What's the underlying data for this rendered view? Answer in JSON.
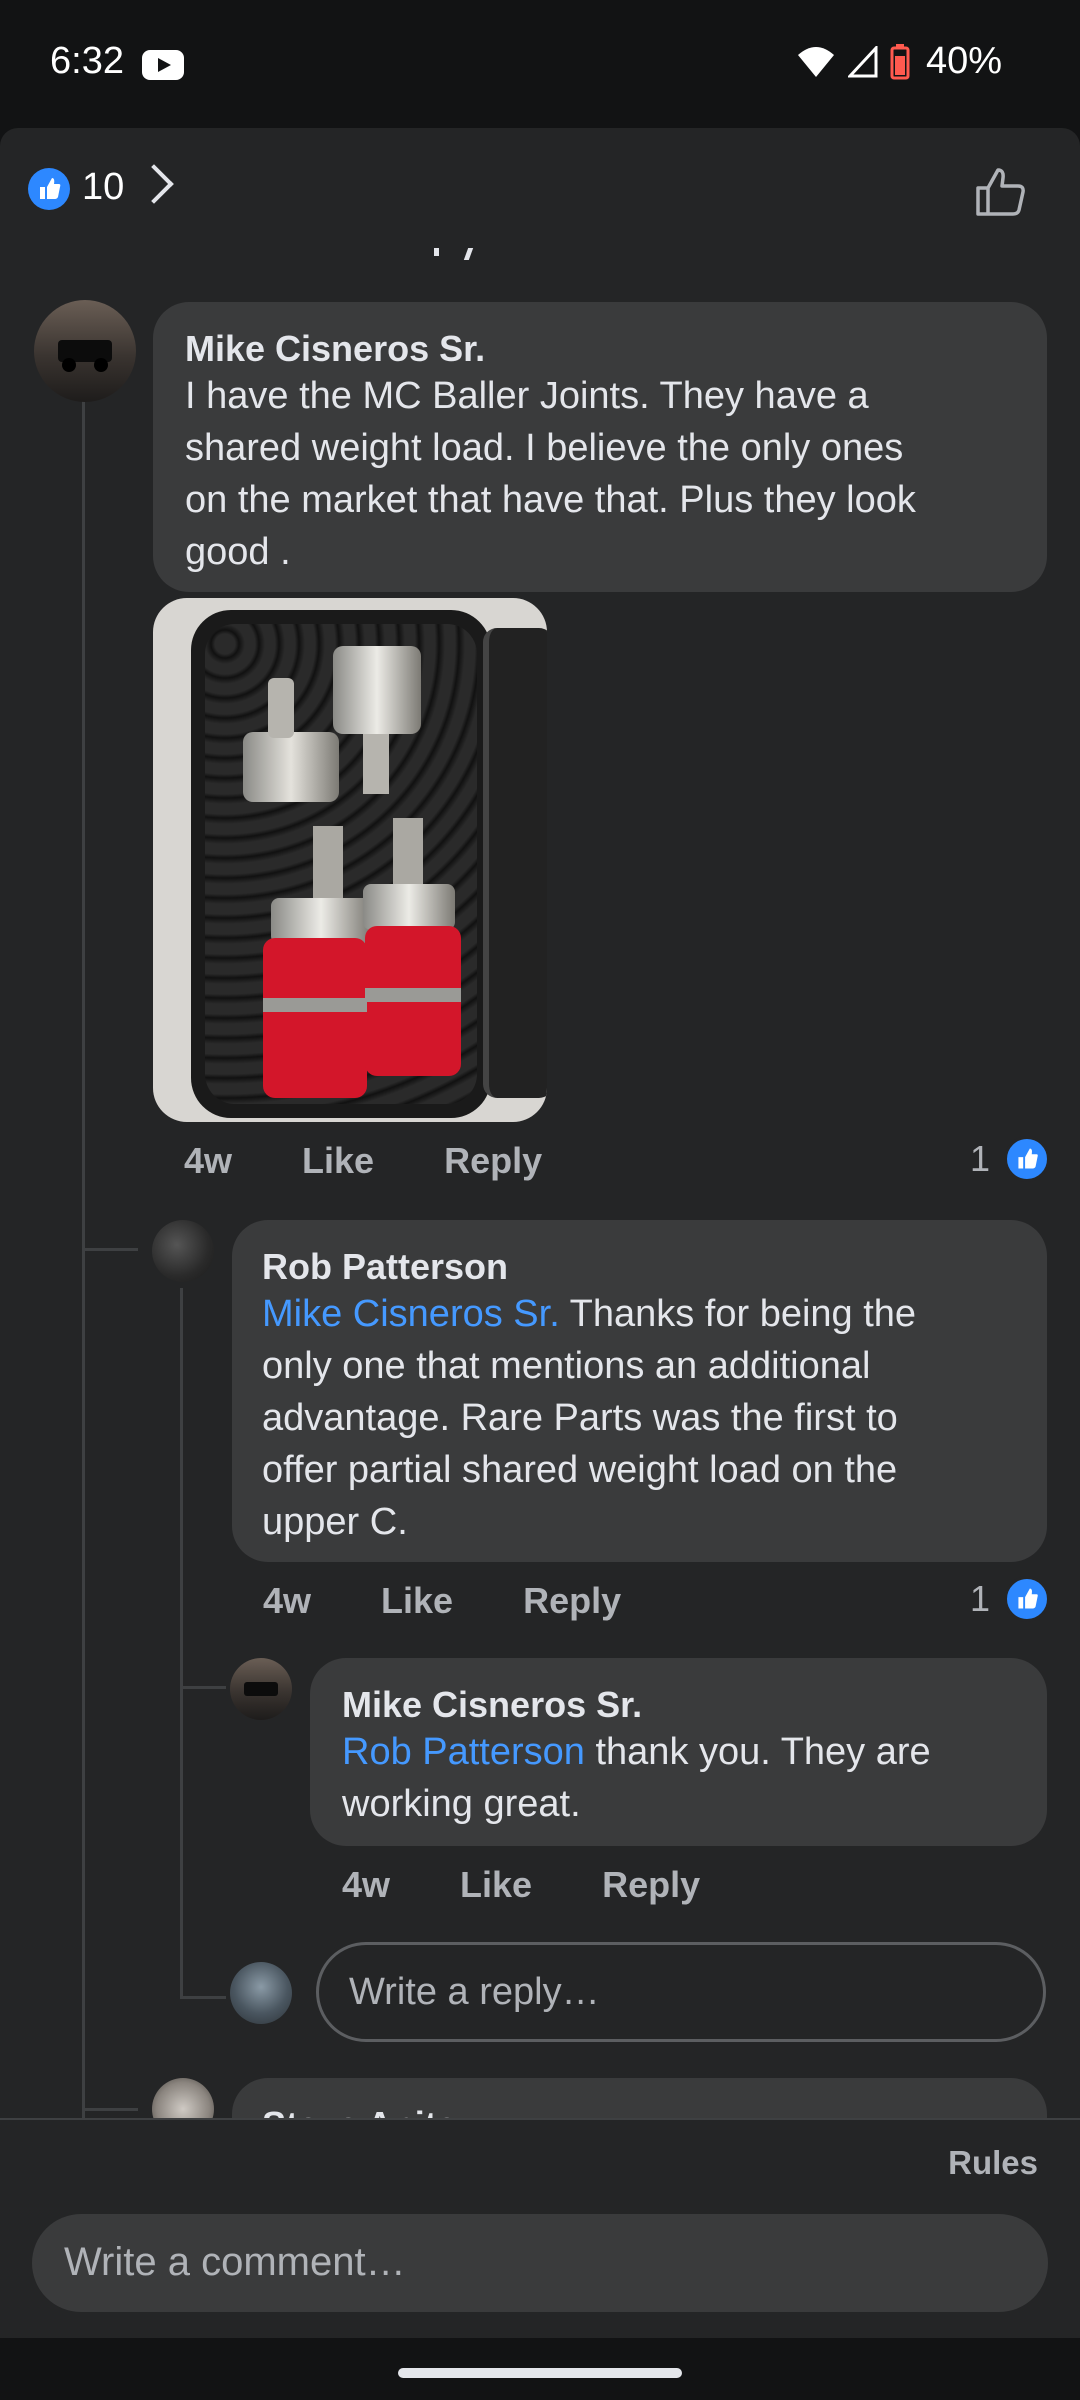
{
  "status_bar": {
    "time": "6:32",
    "battery": "40%",
    "icons": [
      "youtube-icon",
      "wifi-icon",
      "signal-icon",
      "battery-low-icon"
    ]
  },
  "header": {
    "reaction_count": "10",
    "icons": [
      "like-reaction-icon",
      "chevron-right-icon",
      "thumbs-up-outline-icon"
    ]
  },
  "comments": [
    {
      "author": "Mike Cisneros Sr.",
      "text": "I have the MC Baller Joints.  They have a shared weight load. I believe the only ones on the market that have that. Plus they look good .",
      "lines": [
        "I have the MC Baller Joints.  They have a",
        "shared weight load. I believe the only ones",
        "on the market that have that. Plus they look",
        "good ."
      ],
      "time": "4w",
      "like": "Like",
      "reply": "Reply",
      "reactions": "1"
    },
    {
      "author": "Rob Patterson",
      "mention": "Mike Cisneros Sr.",
      "lines_after_mention": [
        " Thanks for being the",
        "only one that mentions an additional",
        "advantage. Rare Parts was the first to",
        "offer partial shared weight load on the",
        "upper C."
      ],
      "time": "4w",
      "like": "Like",
      "reply": "Reply",
      "reactions": "1"
    },
    {
      "author": "Mike Cisneros Sr.",
      "mention": "Rob Patterson",
      "lines_after_mention": [
        " thank you.  They are",
        "working great."
      ],
      "time": "4w",
      "like": "Like",
      "reply": "Reply"
    },
    {
      "author": "Steve Anita"
    }
  ],
  "reply_box": {
    "placeholder": "Write a reply…"
  },
  "composer": {
    "rules": "Rules",
    "placeholder": "Write a comment…"
  },
  "colors": {
    "accent": "#2d88ff",
    "mention": "#4599ff",
    "bubble": "#3a3b3c",
    "panel": "#242526"
  }
}
